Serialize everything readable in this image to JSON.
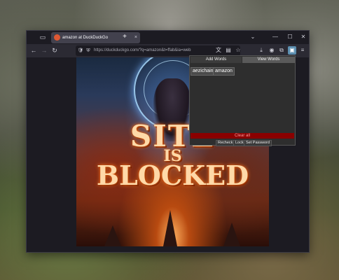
{
  "browser": {
    "tab": {
      "title": "amazon at DuckDuckGo",
      "close": "×"
    },
    "new_tab": "+",
    "window_controls": {
      "list": "⌄",
      "minimize": "—",
      "maximize": "☐",
      "close": "✕"
    },
    "nav": {
      "back": "←",
      "forward": "→",
      "reload": "↻"
    },
    "url": "https://duckduckgo.com/?q=amazon&t=ffab&ia=web",
    "url_icons": {
      "shield": "🛡",
      "lock": "⛨"
    },
    "toolbar_icons": {
      "translate": "文",
      "reader": "▤",
      "bookmark": "☆",
      "downloads": "⤓",
      "account": "◉",
      "extensions": "⧉",
      "blocker": "▣",
      "menu": "≡"
    }
  },
  "page": {
    "image_text": {
      "line1": "SITE",
      "line2": "IS",
      "line3": "BLOCKED"
    }
  },
  "popup": {
    "tabs": {
      "add": "Add Words",
      "view": "View Words"
    },
    "words": [
      "aezichain",
      "amazon"
    ],
    "clear_all": "Clear all",
    "buttons": {
      "recheck": "Recheck",
      "lock": "Lock",
      "set_password": "Set Password"
    }
  },
  "colors": {
    "accent": "#5c8fb0",
    "danger": "#8a0000",
    "browser_bg": "#1c1b22"
  }
}
